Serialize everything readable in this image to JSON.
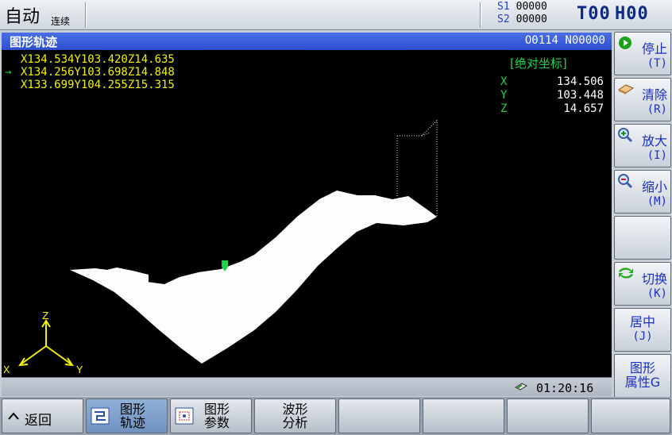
{
  "status": {
    "mode": "自动",
    "sub_mode": "连续",
    "s1_label": "S1",
    "s1_value": "00000",
    "s2_label": "S2",
    "s2_value": "00000",
    "tool": "T00",
    "h": "H00"
  },
  "panel": {
    "title": "图形轨迹",
    "program": "O0114 N00000",
    "coord_lines": [
      "X134.534Y103.420Z14.635",
      "X134.256Y103.698Z14.848",
      "X133.699Y104.255Z15.315"
    ],
    "current_marker": "→",
    "abs_title": "[绝对坐标]",
    "axes": [
      {
        "name": "X",
        "value": "134.506"
      },
      {
        "name": "Y",
        "value": "103.448"
      },
      {
        "name": "Z",
        "value": "14.657"
      }
    ],
    "triad": {
      "x": "X",
      "y": "Y",
      "z": "Z"
    },
    "time": "01:20:16"
  },
  "right_keys": [
    {
      "label": "停止",
      "key": "(T)",
      "icon": "stop-icon"
    },
    {
      "label": "清除",
      "key": "(R)",
      "icon": "eraser-icon"
    },
    {
      "label": "放大",
      "key": "(I)",
      "icon": "zoom-in-icon"
    },
    {
      "label": "缩小",
      "key": "(M)",
      "icon": "zoom-out-icon"
    },
    {
      "label": "",
      "key": "",
      "icon": ""
    },
    {
      "label": "切换",
      "key": "(K)",
      "icon": "switch-icon"
    },
    {
      "label": "居中",
      "key": "(J)",
      "icon": ""
    },
    {
      "label": "图形",
      "key": "属性G",
      "icon": ""
    }
  ],
  "bottom_keys": [
    {
      "line1": "返回",
      "line2": "",
      "icon": "chevron-up-icon"
    },
    {
      "line1": "图形",
      "line2": "轨迹",
      "icon": "trajectory-icon",
      "active": true
    },
    {
      "line1": "图形",
      "line2": "参数",
      "icon": "params-icon"
    },
    {
      "line1": "波形",
      "line2": "分析",
      "icon": ""
    },
    {
      "line1": "",
      "line2": "",
      "icon": ""
    },
    {
      "line1": "",
      "line2": "",
      "icon": ""
    },
    {
      "line1": "",
      "line2": "",
      "icon": ""
    },
    {
      "line1": "",
      "line2": "",
      "icon": ""
    }
  ],
  "colors": {
    "header_blue": "#2d4fd0",
    "coord_yellow": "#f2f200",
    "axis_green": "#22d24a",
    "softkey_text": "#1a2fc4"
  }
}
